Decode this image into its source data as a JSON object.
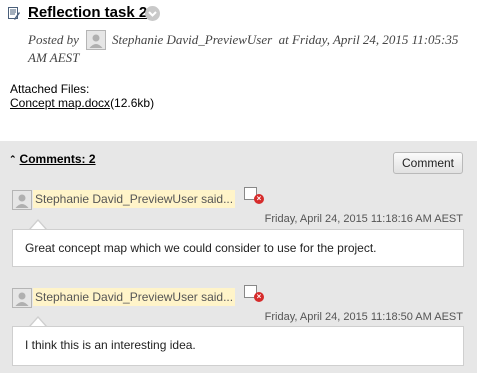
{
  "post": {
    "title": "Reflection task 2",
    "posted_by_label": "Posted by",
    "author": "Stephanie David_PreviewUser",
    "time_line1": "at Friday, April 24, 2015 11:05:35",
    "time_line2": "AM AEST"
  },
  "attachments": {
    "label": "Attached Files:",
    "file_name": "Concept map.docx",
    "file_size": "(12.6kb)"
  },
  "comments_section": {
    "toggle_label": "Comments: 2",
    "comment_button": "Comment",
    "comments": [
      {
        "author_said": "Stephanie David_PreviewUser said...",
        "date": "Friday, April 24, 2015 11:18:16 AM AEST",
        "text": "Great concept map which we could consider to use for the project."
      },
      {
        "author_said": "Stephanie David_PreviewUser said...",
        "date": "Friday, April 24, 2015 11:18:50 AM AEST",
        "text": "I think this is an interesting idea."
      }
    ]
  }
}
